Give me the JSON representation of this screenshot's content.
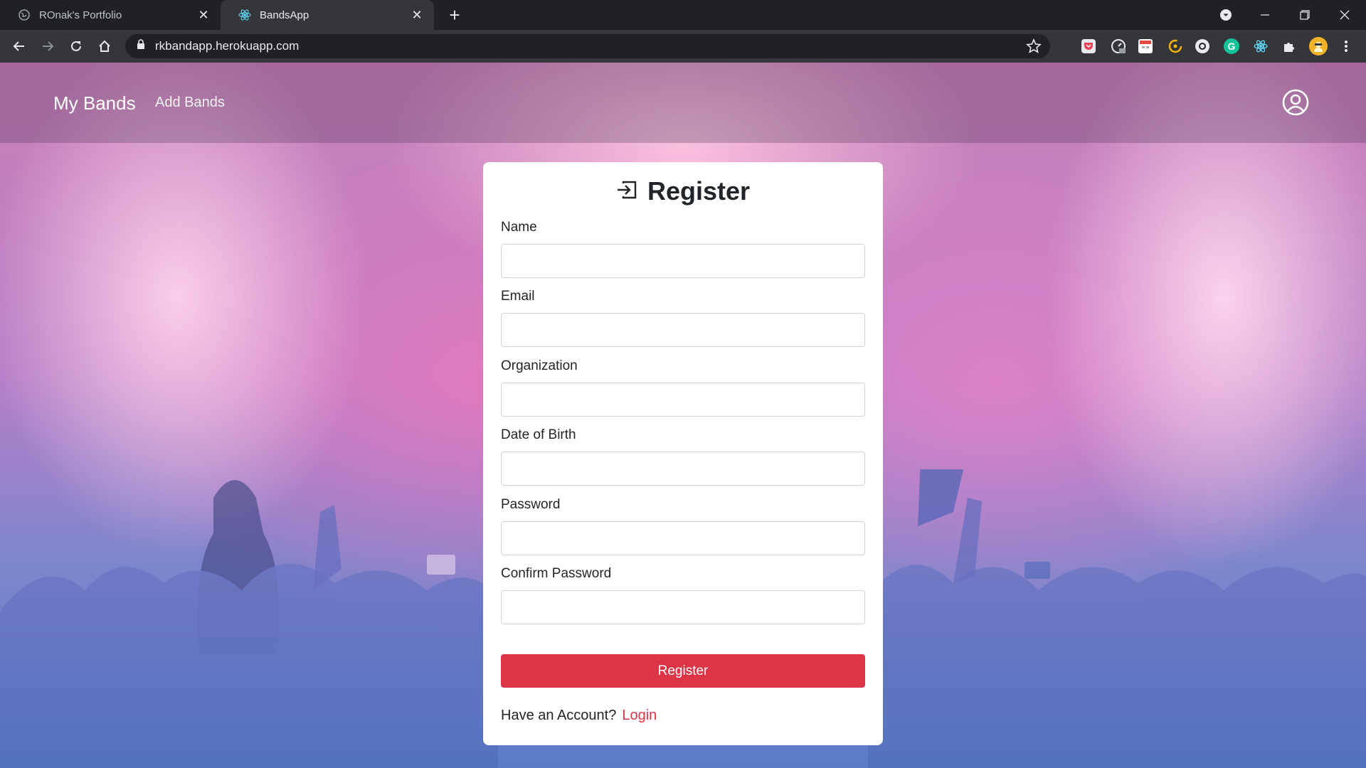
{
  "browser": {
    "tabs": [
      {
        "title": "ROnak's Portfolio",
        "active": false,
        "favicon": "globe-icon"
      },
      {
        "title": "BandsApp",
        "active": true,
        "favicon": "react-icon"
      }
    ],
    "url": "rkbandapp.herokuapp.com",
    "extensions": [
      "pocket-icon",
      "speed-dial-icon",
      "calendar-icon",
      "clockify-icon",
      "dark-reader-icon",
      "grammarly-icon",
      "react-devtools-icon",
      "puzzle-icon",
      "avatar"
    ]
  },
  "navbar": {
    "brand": "My Bands",
    "links": [
      "Add Bands"
    ],
    "user_icon": "user-circle-icon"
  },
  "form": {
    "title": "Register",
    "title_icon": "sign-in-icon",
    "fields": [
      {
        "label": "Name",
        "value": ""
      },
      {
        "label": "Email",
        "value": ""
      },
      {
        "label": "Organization",
        "value": ""
      },
      {
        "label": "Date of Birth",
        "value": ""
      },
      {
        "label": "Password",
        "value": ""
      },
      {
        "label": "Confirm Password",
        "value": ""
      }
    ],
    "submit_label": "Register",
    "footer_text": "Have an Account?",
    "footer_link": "Login"
  },
  "colors": {
    "accent": "#dc3545",
    "chrome_dark": "#202124",
    "chrome_toolbar": "#35363a"
  }
}
